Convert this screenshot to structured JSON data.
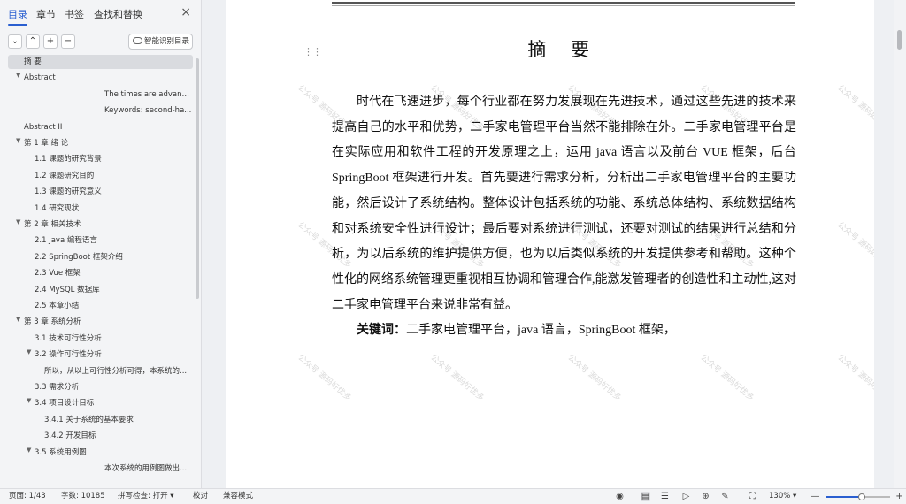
{
  "nav": {
    "tabs": [
      "目录",
      "章节",
      "书签",
      "查找和替换"
    ],
    "close": "×",
    "smart_toc": "智能识别目录",
    "toc": [
      {
        "label": "摘  要",
        "level": 0,
        "caret": ""
      },
      {
        "label": "Abstract",
        "level": 0,
        "caret": "▼"
      },
      {
        "label": "The times are advanci...",
        "level": 3,
        "caret": ""
      },
      {
        "label": "Keywords: second-ha...",
        "level": 3,
        "caret": ""
      },
      {
        "label": "Abstract II",
        "level": 0,
        "caret": ""
      },
      {
        "label": "第 1 章   绪   论",
        "level": 0,
        "caret": "▼"
      },
      {
        "label": "1.1   课题的研究背景",
        "level": 1,
        "caret": ""
      },
      {
        "label": "1.2   课题研究目的",
        "level": 1,
        "caret": ""
      },
      {
        "label": "1.3   课题的研究意义",
        "level": 1,
        "caret": ""
      },
      {
        "label": "1.4   研究现状",
        "level": 1,
        "caret": ""
      },
      {
        "label": "第 2 章   相关技术",
        "level": 0,
        "caret": "▼"
      },
      {
        "label": "2.1 Java 编程语言",
        "level": 1,
        "caret": ""
      },
      {
        "label": "2.2   SpringBoot 框架介绍",
        "level": 1,
        "caret": ""
      },
      {
        "label": "2.3 Vue 框架",
        "level": 1,
        "caret": ""
      },
      {
        "label": "2.4   MySQL 数据库",
        "level": 1,
        "caret": ""
      },
      {
        "label": "2.5  本章小结",
        "level": 1,
        "caret": ""
      },
      {
        "label": "第 3 章   系统分析",
        "level": 0,
        "caret": "▼"
      },
      {
        "label": "3.1   技术可行性分析",
        "level": 1,
        "caret": ""
      },
      {
        "label": "3.2   操作可行性分析",
        "level": 1,
        "caret": "▼"
      },
      {
        "label": "所以，从以上可行性分析可得，本系统的...",
        "level": 2,
        "caret": ""
      },
      {
        "label": "3.3   需求分析",
        "level": 1,
        "caret": ""
      },
      {
        "label": "3.4   项目设计目标",
        "level": 1,
        "caret": "▼"
      },
      {
        "label": "3.4.1 关于系统的基本要求",
        "level": 2,
        "caret": ""
      },
      {
        "label": "3.4.2 开发目标",
        "level": 2,
        "caret": ""
      },
      {
        "label": "3.5 系统用例图",
        "level": 1,
        "caret": "▼"
      },
      {
        "label": "本次系统的用例图做出...",
        "level": 3,
        "caret": ""
      }
    ]
  },
  "doc": {
    "title": "摘 要",
    "paragraph": "时代在飞速进步，每个行业都在努力发展现在先进技术，通过这些先进的技术来提高自己的水平和优势，二手家电管理平台当然不能排除在外。二手家电管理平台是在实际应用和软件工程的开发原理之上，运用 java 语言以及前台 VUE 框架，后台 SpringBoot 框架进行开发。首先要进行需求分析，分析出二手家电管理平台的主要功能，然后设计了系统结构。整体设计包括系统的功能、系统总体结构、系统数据结构和对系统安全性进行设计；最后要对系统进行测试，还要对测试的结果进行总结和分析，为以后系统的维护提供方便，也为以后类似系统的开发提供参考和帮助。这种个性化的网络系统管理更重视相互协调和管理合作,能激发管理者的创造性和主动性,这对二手家电管理平台来说非常有益。",
    "keywords_label": "关键词：",
    "keywords_value": "二手家电管理平台，java 语言，SpringBoot 框架，",
    "watermark": "公众号 源码好优多"
  },
  "status": {
    "page": "页面: 1/43",
    "words": "字数: 10185",
    "spell": "拼写检查: 打开",
    "proof": "校对",
    "compat": "兼容模式",
    "zoom": "130%",
    "zoom_fraction": 0.55
  }
}
